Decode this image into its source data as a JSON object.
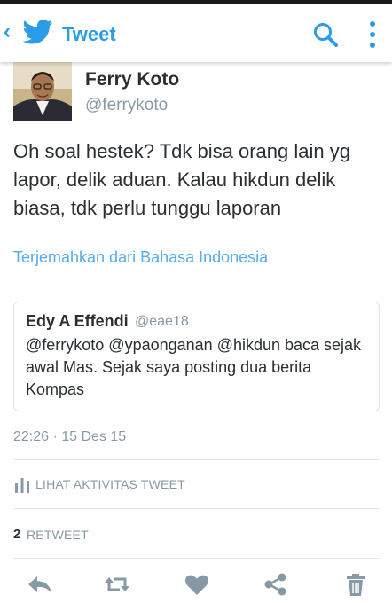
{
  "header": {
    "back_glyph": "‹",
    "title": "Tweet",
    "accent_color": "#2b9ce8"
  },
  "tweet": {
    "author_name": "Ferry Koto",
    "author_handle": "@ferrykoto",
    "text": "Oh soal hestek? Tdk bisa orang lain yg lapor, delik aduan. Kalau hikdun delik biasa, tdk perlu tunggu laporan",
    "translate_label": "Terjemahkan dari Bahasa Indonesia",
    "timestamp": "22:26 · 15 Des 15"
  },
  "quote": {
    "author_name": "Edy A Effendi",
    "author_handle": "@eae18",
    "text": "@ferrykoto @ypaonganan @hikdun baca sejak awal Mas. Sejak saya posting dua berita Kompas"
  },
  "stats": {
    "activity_label": "LIHAT AKTIVITAS TWEET",
    "retweet_count": "2",
    "retweet_label": "RETWEET"
  },
  "actions": {
    "icons": [
      "reply-icon",
      "retweet-icon",
      "like-icon",
      "share-icon",
      "delete-icon"
    ],
    "icon_color": "#8899a6"
  }
}
